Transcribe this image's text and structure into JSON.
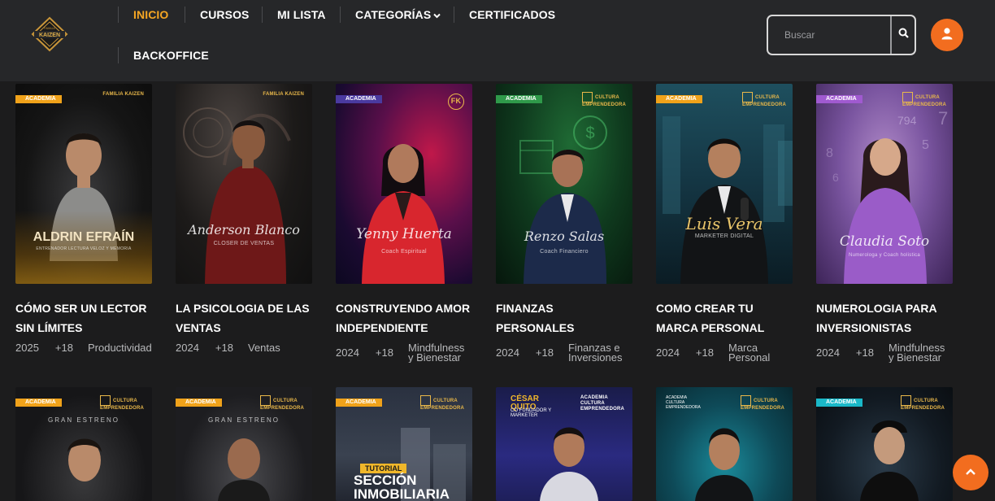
{
  "header": {
    "logo_text": "FAMILIA KAIZEN",
    "nav": {
      "inicio": "INICIO",
      "cursos": "CURSOS",
      "mi_lista": "MI LISTA",
      "categorias": "CATEGORÍAS",
      "certificados": "CERTIFICADOS",
      "backoffice": "BACKOFFICE"
    },
    "search": {
      "placeholder": "Buscar"
    },
    "colors": {
      "active_nav": "#f5a623",
      "accent": "#f26d1f",
      "header_bg": "#262729"
    }
  },
  "courses": [
    {
      "title": "CÓMO SER UN LECTOR SIN LÍMITES",
      "year": "2025",
      "age": "+18",
      "category": "Productividad",
      "badge": "ACADEMIA",
      "brand": "FAMILIA KAIZEN",
      "poster_name": "ALDRIN EFRAÍN",
      "poster_sub": "ENTRENADOR LECTURA VELOZ Y MEMORIA"
    },
    {
      "title": "LA PSICOLOGIA DE LAS VENTAS",
      "year": "2024",
      "age": "+18",
      "category": "Ventas",
      "badge": "",
      "brand": "FAMILIA KAIZEN",
      "poster_name": "Anderson Blanco",
      "poster_sub": "CLOSER DE VENTAS"
    },
    {
      "title": "CONSTRUYENDO AMOR INDEPENDIENTE",
      "year": "2024",
      "age": "+18",
      "category": "Mindfulness y Bienestar",
      "badge": "ACADEMIA",
      "brand": "FK",
      "poster_name": "Yenny Huerta",
      "poster_sub": "Coach Espiritual"
    },
    {
      "title": "FINANZAS PERSONALES",
      "year": "2024",
      "age": "+18",
      "category": "Finanzas e Inversiones",
      "badge": "ACADEMIA",
      "brand": "CULTURA EMPRENDEDORA",
      "poster_name": "Renzo Salas",
      "poster_sub": "Coach Financiero"
    },
    {
      "title": "COMO CREAR TU MARCA PERSONAL",
      "year": "2024",
      "age": "+18",
      "category": "Marca Personal",
      "badge": "ACADEMIA",
      "brand": "CULTURA EMPRENDEDORA",
      "poster_name": "Luis Vera",
      "poster_sub": "MARKETER DIGITAL"
    },
    {
      "title": "NUMEROLOGIA PARA INVERSIONISTAS",
      "year": "2024",
      "age": "+18",
      "category": "Mindfulness y Bienestar",
      "badge": "ACADEMIA",
      "brand": "CULTURA EMPRENDEDORA",
      "poster_name": "Claudia Soto",
      "poster_sub": "Numerologa y Coach holistica"
    }
  ],
  "courses_row2": [
    {
      "badge": "ACADEMIA",
      "brand": "CULTURA EMPRENDEDORA",
      "headline": "GRAN ESTRENO"
    },
    {
      "badge": "ACADEMIA",
      "brand": "CULTURA EMPRENDEDORA",
      "headline": "GRAN ESTRENO"
    },
    {
      "badge": "ACADEMIA",
      "brand": "CULTURA EMPRENDEDORA",
      "headline": "TUTORIAL",
      "headline2": "SECCIÓN INMOBILIARIA"
    },
    {
      "badge": "",
      "brand": "ACADEMIA CULTURA EMPRENDEDORA",
      "headline": "CÉSAR QUITO",
      "headline2": "CO FUNDADOR Y MARKETER"
    },
    {
      "badge": "",
      "brand": "CULTURA EMPRENDEDORA",
      "headline": "ACADEMIA CULTURA EMPRENDEDORA"
    },
    {
      "badge": "ACADEMIA",
      "brand": "CULTURA EMPRENDEDORA",
      "headline": ""
    }
  ]
}
